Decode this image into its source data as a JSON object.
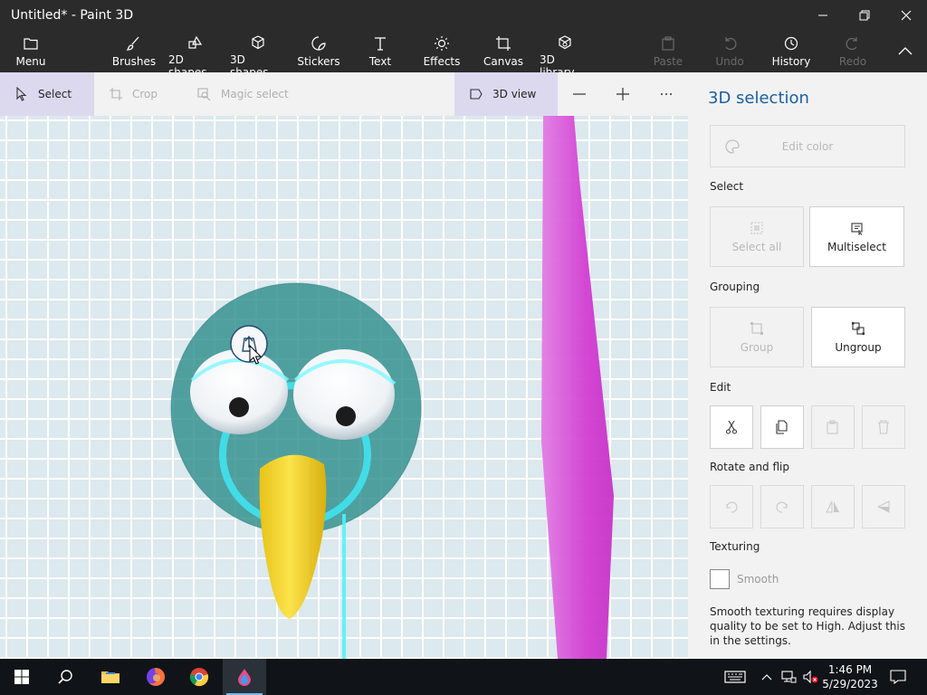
{
  "window": {
    "title": "Untitled* - Paint 3D"
  },
  "ribbon": {
    "menu": "Menu",
    "brushes": "Brushes",
    "shapes_2d": "2D shapes",
    "shapes_3d": "3D shapes",
    "stickers": "Stickers",
    "text": "Text",
    "effects": "Effects",
    "canvas": "Canvas",
    "library_3d": "3D library",
    "paste": "Paste",
    "undo": "Undo",
    "history": "History",
    "redo": "Redo"
  },
  "toolbar": {
    "select": "Select",
    "crop": "Crop",
    "magic_select": "Magic select",
    "view_3d": "3D view"
  },
  "panel": {
    "title": "3D selection",
    "edit_color": "Edit color",
    "select_label": "Select",
    "select_all": "Select all",
    "multiselect": "Multiselect",
    "grouping_label": "Grouping",
    "group": "Group",
    "ungroup": "Ungroup",
    "edit_label": "Edit",
    "rotate_label": "Rotate and flip",
    "texturing_label": "Texturing",
    "smooth": "Smooth",
    "smooth_note": "Smooth texturing requires display quality to be set to High. Adjust this in the settings."
  },
  "taskbar": {
    "time": "1:46 PM",
    "date": "5/29/2023"
  },
  "colors": {
    "chrome": "#2b2b2b",
    "accent": "#1a5f9e",
    "face": "#2f8f8c",
    "beak": "#f5d526",
    "stripe": "#d946d6"
  }
}
